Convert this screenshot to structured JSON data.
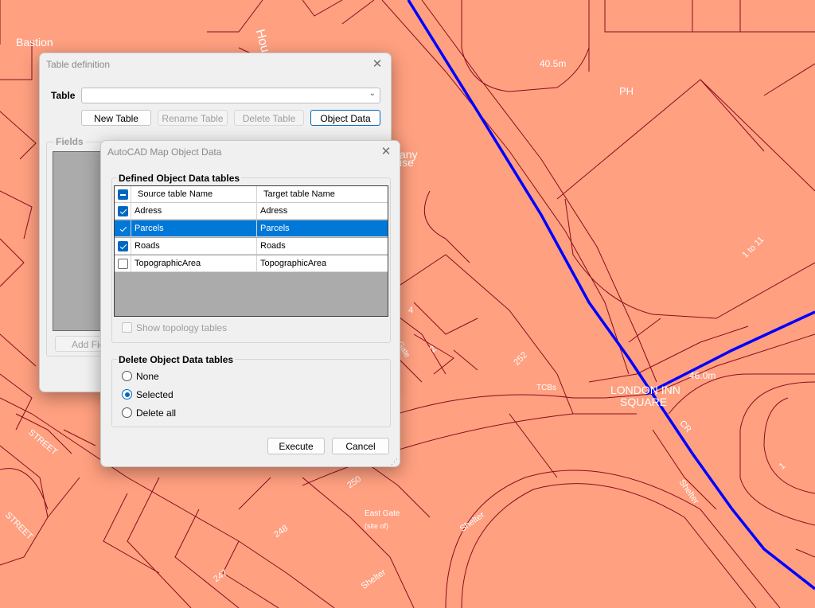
{
  "map": {
    "labels": {
      "bastion": "Bastion",
      "house": "House",
      "distance_top": "40.5m",
      "ph": "PH",
      "any": "any",
      "ise": "ise",
      "num_1_to_11": "1 to 11",
      "num_4": "4",
      "num_2": "2",
      "gate": "n Gate",
      "num_252": "252",
      "tcbs": "TCBs",
      "london_inn": "LONDON INN",
      "square": "SQUARE",
      "distance_right": "46.0m",
      "cr": "CR",
      "num_250": "250",
      "east_gate": "East Gate",
      "site_of": "(site of)",
      "shelter_1": "Shelter",
      "shelter_2": "Shelter",
      "shelter_3": "Shelter",
      "num_248": "248",
      "num_247": "247",
      "street_1": "STREET",
      "street_2": "STREET",
      "num_1": "1"
    },
    "colors": {
      "fill": "#ffa080",
      "lines": "#8b0a1e",
      "route": "#0000ff",
      "label": "#ffffff"
    }
  },
  "table_definition": {
    "title": "Table definition",
    "table_label": "Table",
    "table_value": "",
    "buttons": {
      "new_table": "New Table",
      "rename_table": "Rename Table",
      "delete_table": "Delete Table",
      "object_data": "Object Data"
    },
    "fields_label": "Fields",
    "add_field": "Add Fie"
  },
  "object_data": {
    "title": "AutoCAD Map Object Data",
    "defined_group": "Defined Object Data tables",
    "columns": {
      "source": "Source table Name",
      "target": "Target table Name"
    },
    "rows": [
      {
        "source": "Adress",
        "target": "Adress",
        "checked": true,
        "selected": false
      },
      {
        "source": "Parcels",
        "target": "Parcels",
        "checked": true,
        "selected": true
      },
      {
        "source": "Roads",
        "target": "Roads",
        "checked": true,
        "selected": false
      },
      {
        "source": "TopographicArea",
        "target": "TopographicArea",
        "checked": false,
        "selected": false
      }
    ],
    "show_topology": "Show topology tables",
    "delete_group": "Delete Object Data tables",
    "options": {
      "none": "None",
      "selected": "Selected",
      "delete_all": "Delete all"
    },
    "selected_option": "Selected",
    "buttons": {
      "execute": "Execute",
      "cancel": "Cancel"
    },
    "colors": {
      "selection": "#0078d7",
      "accent": "#0067c0"
    }
  }
}
